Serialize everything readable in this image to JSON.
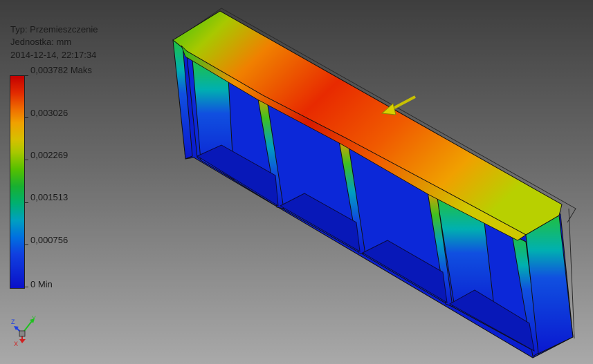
{
  "legend": {
    "type_line": "Typ: Przemieszczenie",
    "unit_line": "Jednostka: mm",
    "date_line": "2014-12-14, 22:17:34",
    "max_label": "0,003782 Maks",
    "tick_1": "0,003026",
    "tick_2": "0,002269",
    "tick_3": "0,001513",
    "tick_4": "0,000756",
    "min_label": "0 Min"
  },
  "triad": {
    "x_label": "X",
    "y_label": "Y",
    "z_label": "Z"
  },
  "colors": {
    "max": "#c40000",
    "min": "#0a10c8",
    "load_arrow": "#d8d000"
  }
}
